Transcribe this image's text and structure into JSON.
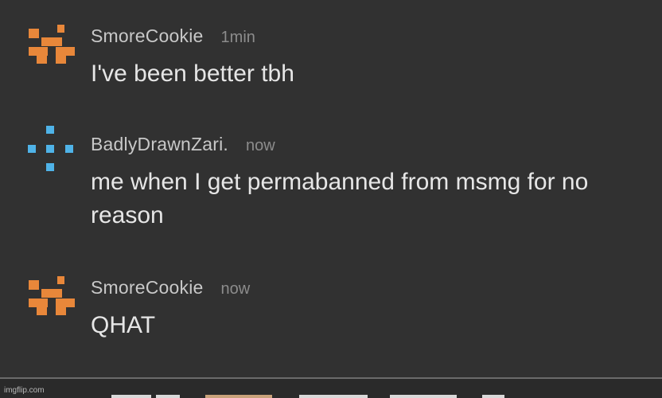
{
  "messages": [
    {
      "username": "SmoreCookie",
      "timestamp": "1min",
      "text": "I've been better tbh",
      "avatar": "orange-pixel-avatar-icon"
    },
    {
      "username": "BadlyDrawnZari.",
      "timestamp": "now",
      "text": "me when I get permabanned from msmg for no reason",
      "avatar": "blue-pixel-avatar-icon"
    },
    {
      "username": "SmoreCookie",
      "timestamp": "now",
      "text": "QHAT",
      "avatar": "orange-pixel-avatar-icon"
    }
  ],
  "watermark": "imgflip.com",
  "colors": {
    "background": "#313131",
    "orange_avatar": "#e8873a",
    "blue_avatar": "#4fb3e8",
    "username": "#c8c8c8",
    "timestamp": "#8c8c8c",
    "message_text": "#e6e6e6"
  }
}
